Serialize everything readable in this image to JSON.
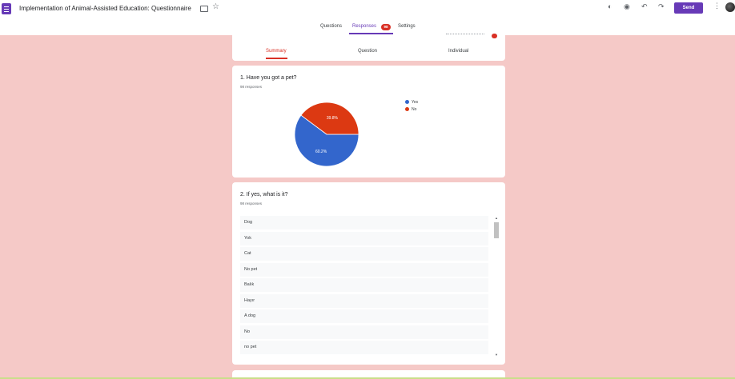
{
  "header": {
    "title": "Implementation of Animal-Assisted Education: Questionnaire",
    "send_label": "Send",
    "tabs": [
      {
        "label": "Questions"
      },
      {
        "label": "Responses",
        "badge": "98"
      },
      {
        "label": "Settings"
      }
    ]
  },
  "summary_tabs": [
    {
      "label": "Summary"
    },
    {
      "label": "Question"
    },
    {
      "label": "Individual"
    }
  ],
  "q1": {
    "title": "1. Have you got a pet?",
    "count": "98 responses"
  },
  "chart_data": {
    "type": "pie",
    "labels": [
      "Yes",
      "No"
    ],
    "values": [
      60.2,
      39.8
    ],
    "value_labels": [
      "60.2%",
      "39.8%"
    ],
    "colors": [
      "#3366cc",
      "#dc3912"
    ],
    "legend_position": "right"
  },
  "q2": {
    "title": "2. If yes, what is it?",
    "count": "98 responses",
    "responses": [
      "Dog",
      "Yok",
      "Cat",
      "No pet",
      "Balık",
      "Hayır",
      "A dog",
      "No",
      "no pet"
    ]
  },
  "icons": [
    "palette-icon",
    "preview-icon",
    "undo-icon",
    "redo-icon",
    "more-vert-icon",
    "folder-icon",
    "star-icon"
  ]
}
